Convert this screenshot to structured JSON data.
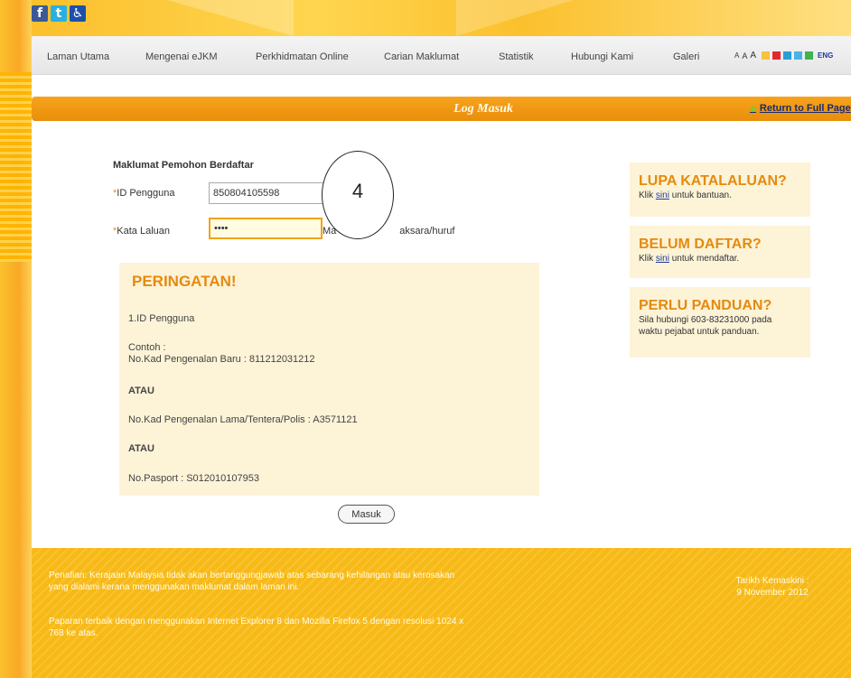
{
  "social": {
    "facebook": "f",
    "twitter": "t",
    "accessibility": "♿"
  },
  "nav": {
    "items": [
      "Laman Utama",
      "Mengenai eJKM",
      "Perkhidmatan Online",
      "Carian Maklumat",
      "Statistik",
      "Hubungi Kami",
      "Galeri"
    ],
    "font_sizes": [
      "A",
      "A",
      "A"
    ],
    "lang": "ENG",
    "theme_colors": [
      "#f5c242",
      "#e5272e",
      "#2a9fd6",
      "#49b4e8",
      "#3fb34f"
    ]
  },
  "page": {
    "title": "Log Masuk",
    "return_link": "Return to Full Page"
  },
  "form": {
    "heading": "Maklumat Pemohon Berdaftar",
    "user_label": "ID Pengguna",
    "user_value": "850804105598",
    "pass_label": "Kata Laluan",
    "pass_value": "••••",
    "pass_hint_start": "Ma",
    "pass_hint_end": "aksara/huruf",
    "circle_number": "4",
    "submit_label": "Masuk"
  },
  "warning": {
    "title": "PERINGATAN!",
    "line1": "1.ID Pengguna",
    "line2": "Contoh :",
    "line3": "No.Kad Pengenalan Baru : 811212031212",
    "or1": "ATAU",
    "line4": "No.Kad Pengenalan Lama/Tentera/Polis : A3571121",
    "or2": "ATAU",
    "line5": "No.Pasport : S012010107953"
  },
  "sidebar": {
    "forgot": {
      "title": "LUPA KATALALUAN?",
      "pre": "Klik ",
      "link": "sini",
      "post": " untuk bantuan."
    },
    "register": {
      "title": "BELUM DAFTAR?",
      "pre": "Klik ",
      "link": "sini",
      "post": " untuk mendaftar."
    },
    "guide": {
      "title": "PERLU PANDUAN?",
      "line1": "Sila hubungi 603-83231000 pada",
      "line2": "waktu pejabat untuk panduan."
    }
  },
  "footer": {
    "disclaimer1": "Penafian: Kerajaan Malaysia tidak akan bertanggungjawab atas sebarang kehilangan atau kerosakan",
    "disclaimer2": "yang dialami kerana menggunakan maklumat dalam laman ini.",
    "browser1": "Paparan terbaik dengan menggunakan Internet Explorer 8 dan Mozilla Firefox 5 dengan resolusi 1024 x",
    "browser2": "768 ke atas.",
    "updated_label": "Tarikh Kemaskini :",
    "updated_date": "9 November 2012"
  }
}
